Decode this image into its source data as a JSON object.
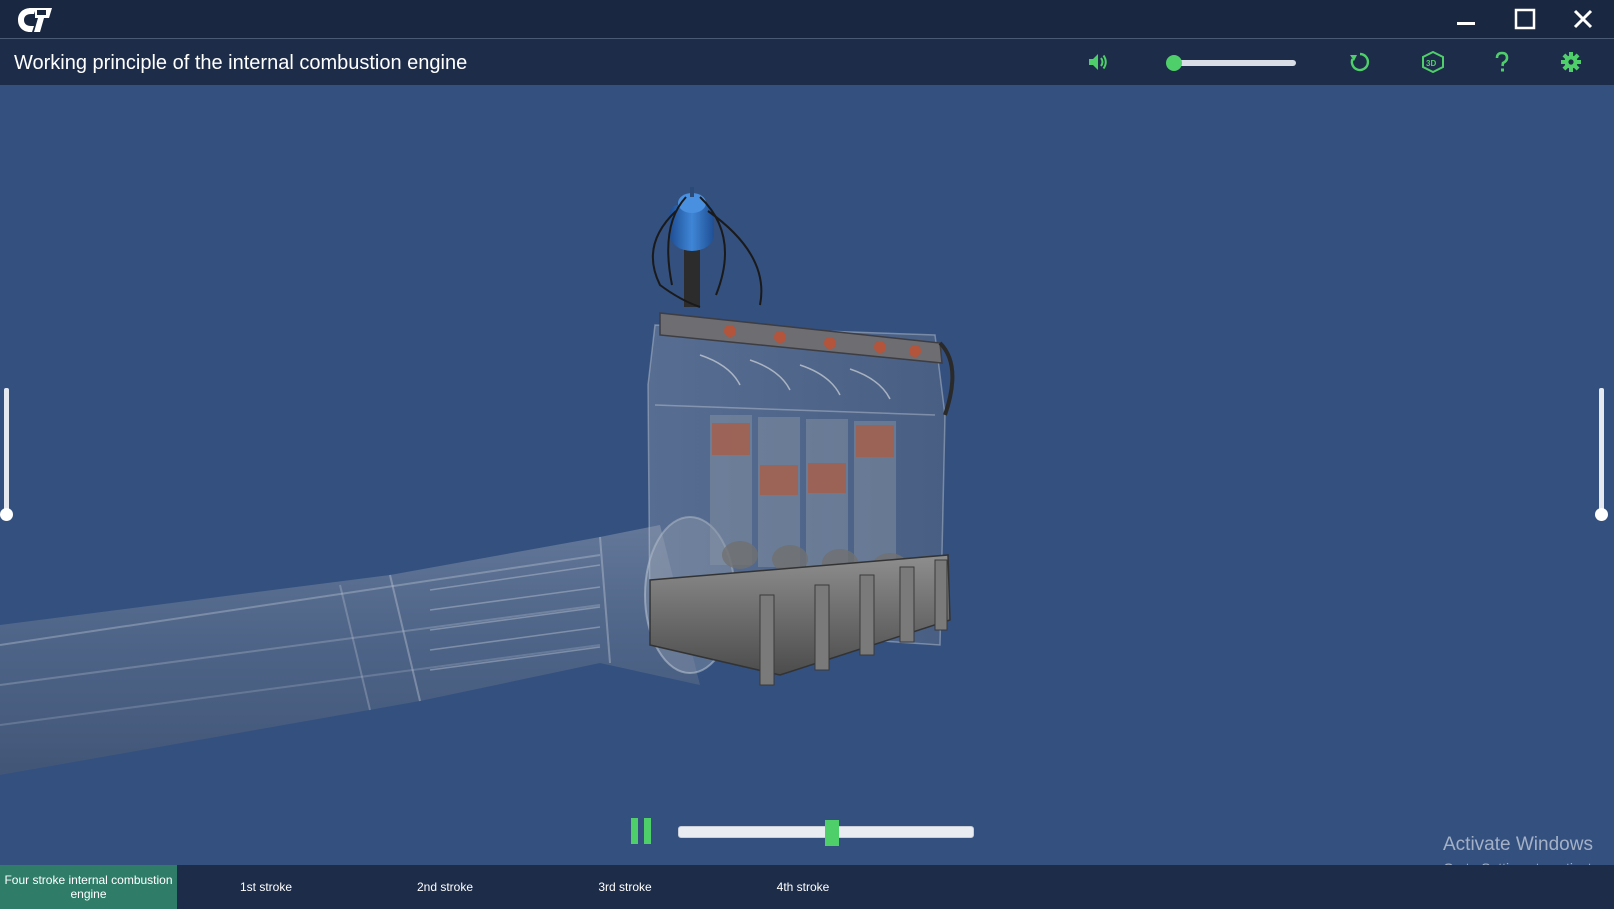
{
  "window": {
    "title": "Working principle of the internal combustion engine",
    "controls": [
      "minimize-icon",
      "maximize-icon",
      "close-icon"
    ]
  },
  "toolbar": {
    "icons": [
      "speaker-icon",
      "restart-icon",
      "3d-cube-icon",
      "help-icon",
      "gear-icon"
    ],
    "volume_level": 0.02,
    "accent_color": "#4fcf6a"
  },
  "playback": {
    "state": "playing",
    "progress": 0.52
  },
  "side_sliders": {
    "left_level": 0.0,
    "right_level": 0.0
  },
  "tabs": [
    {
      "label": "Four stroke internal combustion engine",
      "active": true
    },
    {
      "label": "1st stroke",
      "active": false
    },
    {
      "label": "2nd stroke",
      "active": false
    },
    {
      "label": "3rd stroke",
      "active": false
    },
    {
      "label": "4th stroke",
      "active": false
    }
  ],
  "watermark": {
    "title": "Activate Windows",
    "subtitle": "Go to Settings to activate"
  },
  "colors": {
    "background": "#33507f",
    "bar": "#1d2c48",
    "active_tab": "#2f7d68"
  }
}
